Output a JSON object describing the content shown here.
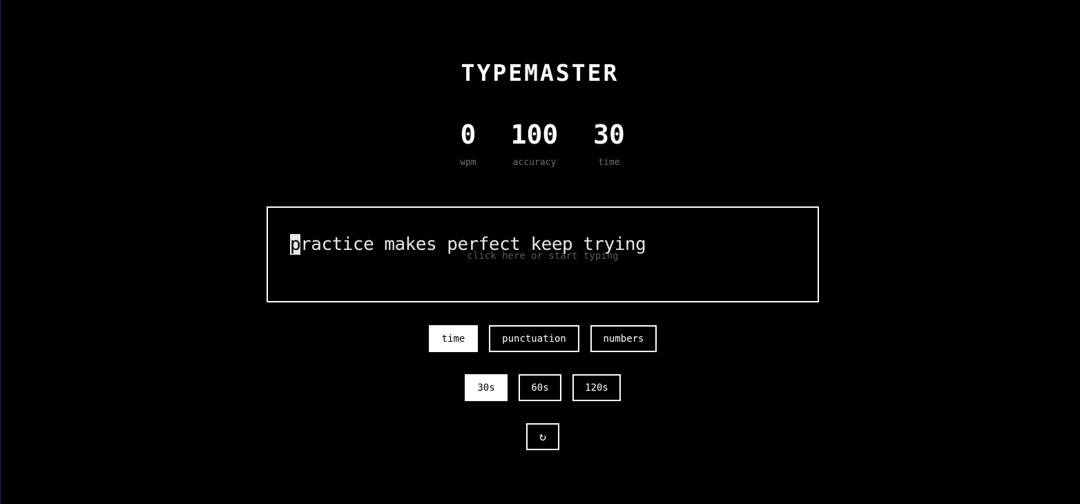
{
  "app": {
    "title": "TYPEMASTER"
  },
  "stats": {
    "wpm": {
      "value": "0",
      "label": "wpm"
    },
    "accuracy": {
      "value": "100",
      "label": "accuracy"
    },
    "time": {
      "value": "30",
      "label": "time"
    }
  },
  "typing": {
    "current_char": "p",
    "remaining_text": "ractice makes perfect keep trying",
    "hint": "click here or start typing"
  },
  "modes": {
    "time": {
      "label": "time",
      "active": true
    },
    "punctuation": {
      "label": "punctuation",
      "active": false
    },
    "numbers": {
      "label": "numbers",
      "active": false
    }
  },
  "durations": {
    "d30": {
      "label": "30s",
      "active": true
    },
    "d60": {
      "label": "60s",
      "active": false
    },
    "d120": {
      "label": "120s",
      "active": false
    }
  },
  "restart": {
    "icon": "restart-icon",
    "glyph": "↻"
  },
  "colors": {
    "background": "#000000",
    "foreground": "#ffffff",
    "muted": "#6f6f6f",
    "hint": "#5a5a5a"
  }
}
